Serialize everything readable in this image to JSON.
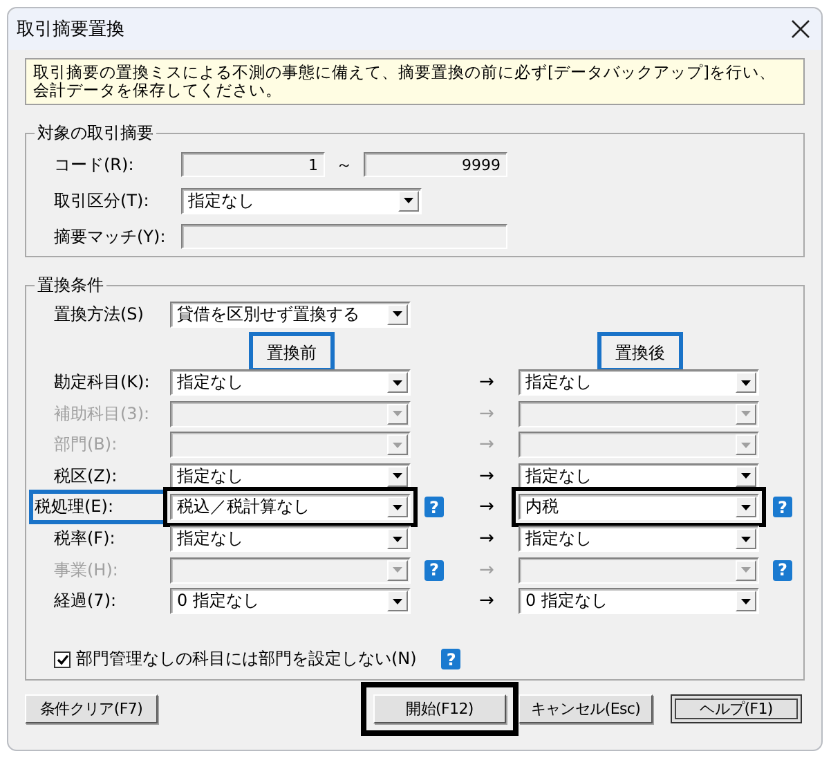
{
  "window": {
    "title": "取引摘要置換"
  },
  "notice": [
    "取引摘要の置換ミスによる不測の事態に備えて、摘要置換の前に必ず[データバックアップ]を行い、",
    "会計データを保存してください。"
  ],
  "target_group": {
    "title": "対象の取引摘要",
    "code": {
      "label": "コード(R):",
      "from": "1",
      "separator": "～",
      "to": "9999"
    },
    "category": {
      "label": "取引区分(T):",
      "value": "指定なし"
    },
    "match": {
      "label": "摘要マッチ(Y):"
    }
  },
  "replace_group": {
    "title": "置換条件",
    "method": {
      "label": "置換方法(S)",
      "value": "貸借を区別せず置換する"
    },
    "headers": [
      {
        "label": "置換前",
        "marked": true
      },
      {
        "label": "置換後",
        "marked": true
      }
    ],
    "rows": [
      {
        "label": "勘定科目(K):",
        "disabled": false,
        "label_marked": false,
        "arrow": "→",
        "before": {
          "value": "指定なし",
          "marked": false
        },
        "after": {
          "value": "指定なし",
          "marked": false
        }
      },
      {
        "label": "補助科目(3):",
        "disabled": true,
        "label_marked": false,
        "arrow": "→",
        "before": {
          "marked": false
        },
        "after": {
          "marked": false
        }
      },
      {
        "label": "部門(B):",
        "disabled": true,
        "label_marked": false,
        "arrow": "→",
        "before": {
          "marked": false
        },
        "after": {
          "marked": false
        }
      },
      {
        "label": "税区(Z):",
        "disabled": false,
        "label_marked": false,
        "arrow": "→",
        "before": {
          "value": "指定なし",
          "marked": false
        },
        "after": {
          "value": "指定なし",
          "marked": false
        }
      },
      {
        "label": "税処理(E):",
        "disabled": false,
        "label_marked": true,
        "arrow": "→",
        "help": "?",
        "before": {
          "value": "税込／税計算なし",
          "marked": true
        },
        "after": {
          "value": "内税",
          "marked": true
        }
      },
      {
        "label": "税率(F):",
        "disabled": false,
        "label_marked": false,
        "arrow": "→",
        "before": {
          "value": "指定なし",
          "marked": false
        },
        "after": {
          "value": "指定なし",
          "marked": false
        }
      },
      {
        "label": "事業(H):",
        "disabled": true,
        "label_marked": false,
        "arrow": "→",
        "help": "?",
        "before": {
          "marked": false
        },
        "after": {
          "marked": false
        }
      },
      {
        "label": "経過(7):",
        "disabled": false,
        "label_marked": false,
        "arrow": "→",
        "before": {
          "value": "0 指定なし",
          "marked": false
        },
        "after": {
          "value": "0 指定なし",
          "marked": false
        }
      }
    ],
    "checkbox": {
      "label": "部門管理なしの科目には部門を設定しない(N)",
      "checked": true,
      "help": "?"
    }
  },
  "buttons": [
    {
      "label": "条件クリア(F7)",
      "marked": false,
      "focused": false
    },
    {
      "label": "開始(F12)",
      "marked": true,
      "focused": false
    },
    {
      "label": "キャンセル(Esc)",
      "marked": false,
      "focused": false
    },
    {
      "label": "ヘルプ(F1)",
      "marked": false,
      "focused": true
    }
  ]
}
